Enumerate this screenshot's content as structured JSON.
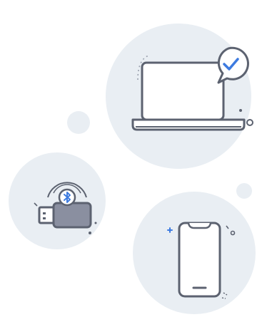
{
  "illustration": {
    "icons": [
      "laptop-icon",
      "checkmark-badge-icon",
      "bluetooth-dongle-icon",
      "bluetooth-icon",
      "smartphone-icon"
    ],
    "colors": {
      "circle_background": "#e9eef3",
      "device_fill": "#ffffff",
      "device_stroke": "#5c6270",
      "dongle_body": "#8a8fa0",
      "accent_blue": "#3d7be0",
      "sparkle": "#5c6270"
    }
  }
}
